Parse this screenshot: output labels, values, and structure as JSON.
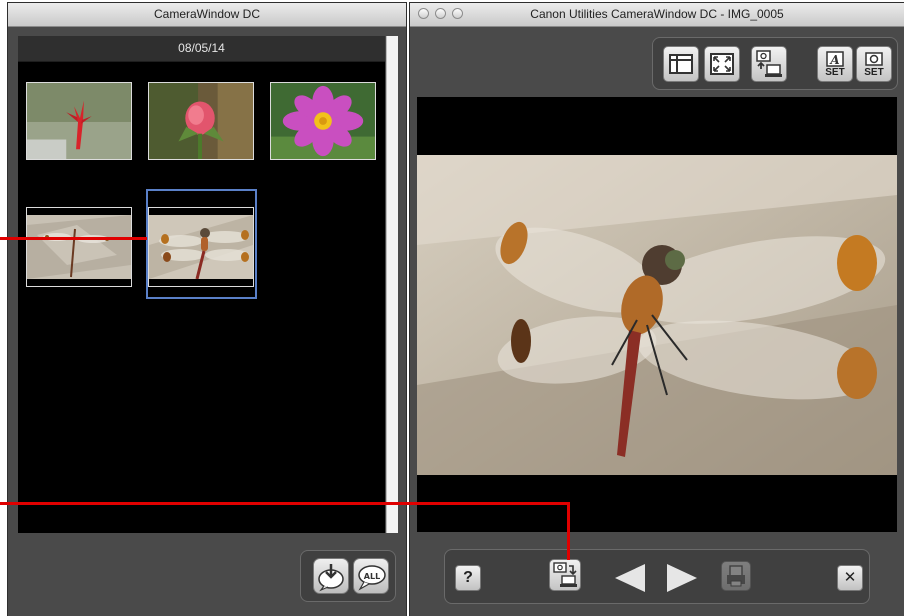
{
  "left_window": {
    "title": "CameraWindow DC",
    "date_header": "08/05/14",
    "thumbnails": [
      {
        "name": "red-flower-bud"
      },
      {
        "name": "pink-rose-bud"
      },
      {
        "name": "pink-cosmos-flower"
      },
      {
        "name": "dragonfly-1"
      },
      {
        "name": "dragonfly-2",
        "selected": true
      }
    ],
    "bottom_buttons": [
      {
        "icon": "import-selected-icon"
      },
      {
        "icon": "import-all-icon",
        "label": "ALL"
      }
    ]
  },
  "right_window": {
    "title": "Canon Utilities CameraWindow DC - IMG_0005",
    "top_toolbar": [
      {
        "icon": "layout-panels-icon"
      },
      {
        "icon": "fullscreen-icon"
      },
      {
        "icon": "camera-to-computer-icon"
      },
      {
        "icon": "camera-settings-a-icon",
        "label": "SET"
      },
      {
        "icon": "camera-settings-icon",
        "label": "SET"
      }
    ],
    "bottom_toolbar": {
      "help_label": "?",
      "close_label": "✕"
    }
  },
  "colors": {
    "window_bg": "#4a4a4a",
    "browser_bg": "#000000",
    "selection": "#5a80c8",
    "callout": "#e00000"
  }
}
